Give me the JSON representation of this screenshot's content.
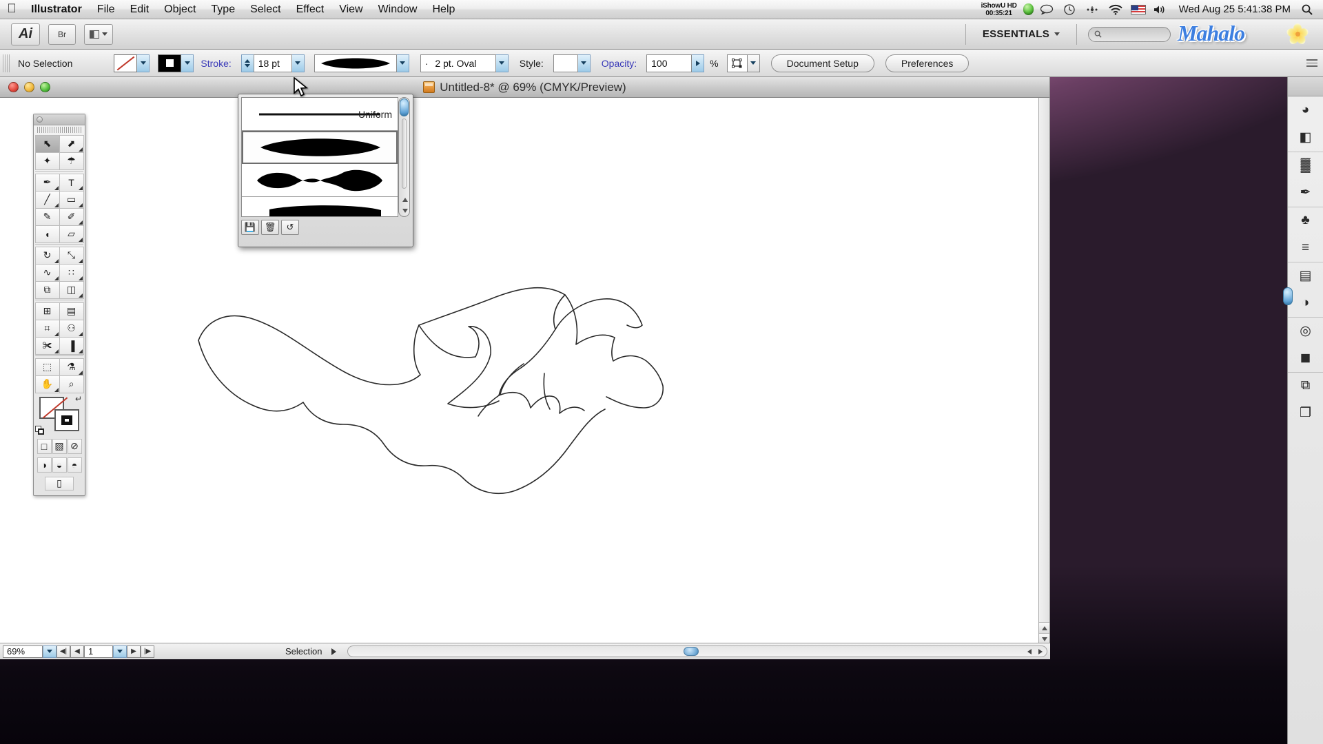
{
  "menubar": {
    "apple_icon": "apple-icon",
    "items": [
      "Illustrator",
      "File",
      "Edit",
      "Object",
      "Type",
      "Select",
      "Effect",
      "View",
      "Window",
      "Help"
    ],
    "status": {
      "ishowu_label": "iShowU HD",
      "ishowu_time": "00:35:21",
      "icons": [
        "recording-indicator-icon",
        "chat-bubble-icon",
        "time-machine-icon",
        "spaces-icon",
        "wifi-icon",
        "us-flag-icon",
        "volume-icon"
      ],
      "clock": "Wed Aug 25  5:41:38 PM",
      "spotlight_icon": "search-icon"
    }
  },
  "appbar": {
    "logo": "Ai",
    "bridge_label": "Br",
    "arrange_icon": "arrange-documents-icon",
    "workspace": "ESSENTIALS",
    "workspace_caret": "chevron-down-icon",
    "search_placeholder": "",
    "brand": "Mahalo"
  },
  "controlbar": {
    "selection_status": "No Selection",
    "fill_swatch": "fill-none-swatch",
    "stroke_swatch": "stroke-black-swatch",
    "stroke_label": "Stroke:",
    "stroke_weight": "18 pt",
    "brush_preview": "calligraphic-oval-brush",
    "profile_bullet": "·",
    "profile_value": "2 pt. Oval",
    "style_label": "Style:",
    "style_value": "",
    "opacity_label": "Opacity:",
    "opacity_value": "100",
    "opacity_unit": "%",
    "transform_icon": "transform-icon",
    "document_setup": "Document Setup",
    "preferences": "Preferences",
    "panel_menu_icon": "panel-menu-icon"
  },
  "document": {
    "title": "Untitled-8* @ 69% (CMYK/Preview)",
    "doc_icon": "illustrator-document-icon",
    "close_button": "close-window-button",
    "minimize_button": "minimize-window-button",
    "zoom_button": "zoom-window-button"
  },
  "statusbar": {
    "zoom_level": "69%",
    "zoom_caret": "chevron-down-icon",
    "first_page_icon": "first-page-icon",
    "prev_page_icon": "previous-page-icon",
    "page_number": "1",
    "page_caret": "chevron-down-icon",
    "next_page_icon": "next-page-icon",
    "last_page_icon": "last-page-icon",
    "status_text": "Selection",
    "status_caret": "status-menu-arrow-icon"
  },
  "toolbox": {
    "rows": [
      [
        {
          "name": "selection-tool",
          "glyph": "⬉",
          "selected": true,
          "flyout": false
        },
        {
          "name": "direct-selection-tool",
          "glyph": "⬈",
          "selected": false,
          "flyout": true
        }
      ],
      [
        {
          "name": "magic-wand-tool",
          "glyph": "✦",
          "selected": false,
          "flyout": false
        },
        {
          "name": "lasso-tool",
          "glyph": "☂",
          "selected": false,
          "flyout": false
        }
      ],
      [
        {
          "name": "pen-tool",
          "glyph": "✒",
          "selected": false,
          "flyout": true
        },
        {
          "name": "type-tool",
          "glyph": "T",
          "selected": false,
          "flyout": true
        }
      ],
      [
        {
          "name": "line-segment-tool",
          "glyph": "╱",
          "selected": false,
          "flyout": true
        },
        {
          "name": "rectangle-tool",
          "glyph": "▭",
          "selected": false,
          "flyout": true
        }
      ],
      [
        {
          "name": "paintbrush-tool",
          "glyph": "✎",
          "selected": false,
          "flyout": false
        },
        {
          "name": "pencil-tool",
          "glyph": "✐",
          "selected": false,
          "flyout": true
        }
      ],
      [
        {
          "name": "blob-brush-tool",
          "glyph": "◖",
          "selected": false,
          "flyout": false
        },
        {
          "name": "eraser-tool",
          "glyph": "▱",
          "selected": false,
          "flyout": true
        }
      ],
      [
        {
          "name": "rotate-tool",
          "glyph": "↻",
          "selected": false,
          "flyout": true
        },
        {
          "name": "scale-tool",
          "glyph": "⤡",
          "selected": false,
          "flyout": true
        }
      ],
      [
        {
          "name": "width-tool",
          "glyph": "∿",
          "selected": false,
          "flyout": true
        },
        {
          "name": "shape-builder-tool",
          "glyph": "∷",
          "selected": false,
          "flyout": true
        }
      ],
      [
        {
          "name": "free-transform-tool",
          "glyph": "⧉",
          "selected": false,
          "flyout": false
        },
        {
          "name": "perspective-grid-tool",
          "glyph": "◫",
          "selected": false,
          "flyout": true
        }
      ],
      [
        {
          "name": "mesh-tool",
          "glyph": "⊞",
          "selected": false,
          "flyout": false
        },
        {
          "name": "gradient-tool",
          "glyph": "▤",
          "selected": false,
          "flyout": false
        }
      ],
      [
        {
          "name": "measure-tool",
          "glyph": "⌗",
          "selected": false,
          "flyout": true
        },
        {
          "name": "symbol-sprayer-tool",
          "glyph": "⚇",
          "selected": false,
          "flyout": true
        }
      ],
      [
        {
          "name": "slice-tool",
          "glyph": "✀",
          "selected": false,
          "flyout": true
        },
        {
          "name": "graph-tool",
          "glyph": "▐",
          "selected": false,
          "flyout": true
        }
      ],
      [
        {
          "name": "artboard-tool",
          "glyph": "⬚",
          "selected": false,
          "flyout": false
        },
        {
          "name": "eyedropper-tool",
          "glyph": "⚗",
          "selected": false,
          "flyout": true
        }
      ],
      [
        {
          "name": "hand-tool",
          "glyph": "✋",
          "selected": false,
          "flyout": true
        },
        {
          "name": "zoom-tool",
          "glyph": "⌕",
          "selected": false,
          "flyout": false
        }
      ]
    ],
    "color_controls": {
      "fill": "fill-none-box",
      "stroke": "stroke-black-box",
      "swap_icon": "swap-fill-stroke-icon",
      "default_icon": "default-fill-stroke-icon"
    },
    "paint_modes": [
      {
        "name": "color-mode-button",
        "glyph": "□"
      },
      {
        "name": "gradient-mode-button",
        "glyph": "▨"
      },
      {
        "name": "none-mode-button",
        "glyph": "⊘"
      }
    ],
    "draw_modes": [
      {
        "name": "draw-normal-button",
        "glyph": "◑"
      },
      {
        "name": "draw-behind-button",
        "glyph": "◒"
      },
      {
        "name": "draw-inside-button",
        "glyph": "◓"
      }
    ],
    "screen_mode": {
      "name": "change-screen-mode-button",
      "glyph": "⬜"
    }
  },
  "brush_panel": {
    "items": [
      {
        "name": "basic-brush",
        "label": "Uniform",
        "type": "flat",
        "selected": false
      },
      {
        "name": "oval-brush-2pt",
        "label": "",
        "type": "oval",
        "selected": true
      },
      {
        "name": "wavy-brush",
        "label": "",
        "type": "wavy",
        "selected": false
      },
      {
        "name": "flat-wide-brush",
        "label": "",
        "type": "wide",
        "selected": false
      }
    ],
    "scrollbar": "brush-panel-scrollbar",
    "footer_buttons": [
      {
        "name": "save-brush-library-button",
        "glyph": "💾"
      },
      {
        "name": "delete-brush-button",
        "glyph": "🗑"
      },
      {
        "name": "reset-brushes-button",
        "glyph": "↺"
      }
    ]
  },
  "dock": {
    "items": [
      {
        "name": "color-panel-icon",
        "glyph": "◕"
      },
      {
        "name": "color-guide-panel-icon",
        "glyph": "◧"
      },
      {
        "name": "swatches-panel-icon",
        "glyph": "▓"
      },
      {
        "name": "brushes-panel-icon",
        "glyph": "✒"
      },
      {
        "name": "symbols-panel-icon",
        "glyph": "♣"
      },
      {
        "name": "stroke-panel-icon",
        "glyph": "≡"
      },
      {
        "name": "gradient-panel-icon",
        "glyph": "▤"
      },
      {
        "name": "transparency-panel-icon",
        "glyph": "◑"
      },
      {
        "name": "appearance-panel-icon",
        "glyph": "◎"
      },
      {
        "name": "graphic-styles-panel-icon",
        "glyph": "◼"
      },
      {
        "name": "layers-panel-icon",
        "glyph": "⧉"
      },
      {
        "name": "artboards-panel-icon",
        "glyph": "❐"
      }
    ],
    "handle": "panel-resize-handle"
  },
  "colors": {
    "accent_blue": "#3a3ab8",
    "brand_blue": "#3d7fe0",
    "stroke_red": "#c0392b",
    "widget_blue": "#9dcbe8"
  }
}
